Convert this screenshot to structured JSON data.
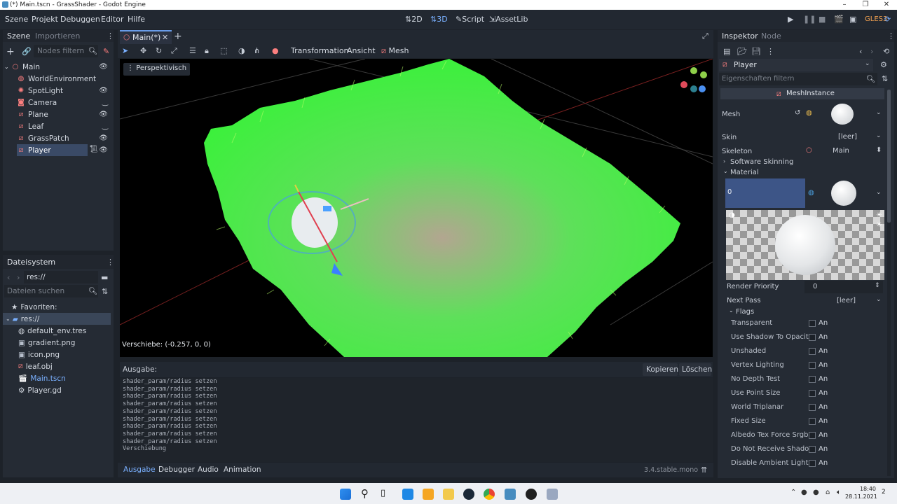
{
  "window": {
    "title": "(*) Main.tscn - GrassShader - Godot Engine"
  },
  "menu": [
    "Szene",
    "Projekt",
    "Debuggen",
    "Editor",
    "Hilfe"
  ],
  "workspaces": [
    {
      "label": "2D",
      "icon": "2d-icon"
    },
    {
      "label": "3D",
      "icon": "3d-icon"
    },
    {
      "label": "Script",
      "icon": "script-icon"
    },
    {
      "label": "AssetLib",
      "icon": "assetlib-icon"
    }
  ],
  "renderer": "GLES3",
  "scene_panel": {
    "tabs": [
      "Szene",
      "Importieren"
    ],
    "filter_placeholder": "Nodes filtern",
    "tree": [
      {
        "label": "Main",
        "icon": "node3d-icon",
        "color": "#fc7f7f"
      },
      {
        "label": "WorldEnvironment",
        "icon": "world-environment-icon",
        "color": "#fc7f7f"
      },
      {
        "label": "SpotLight",
        "icon": "spotlight-icon",
        "color": "#fc7f7f"
      },
      {
        "label": "Camera",
        "icon": "camera-icon",
        "color": "#fc7f7f"
      },
      {
        "label": "Plane",
        "icon": "meshinstance-icon",
        "color": "#fc7f7f"
      },
      {
        "label": "Leaf",
        "icon": "meshinstance-icon",
        "color": "#fc7f7f"
      },
      {
        "label": "GrassPatch",
        "icon": "meshinstance-icon",
        "color": "#fc7f7f"
      },
      {
        "label": "Player",
        "icon": "meshinstance-icon",
        "color": "#fc7f7f",
        "selected": true
      }
    ]
  },
  "filesystem": {
    "title": "Dateisystem",
    "path": "res://",
    "search_placeholder": "Dateien suchen",
    "favorites_label": "Favoriten:",
    "root": "res://",
    "files": [
      {
        "label": "default_env.tres",
        "icon": "environment-icon"
      },
      {
        "label": "gradient.png",
        "icon": "image-icon"
      },
      {
        "label": "icon.png",
        "icon": "image-icon"
      },
      {
        "label": "leaf.obj",
        "icon": "mesh-icon"
      },
      {
        "label": "Main.tscn",
        "icon": "scene-icon",
        "highlight": true
      },
      {
        "label": "Player.gd",
        "icon": "gear-icon"
      }
    ]
  },
  "editor_tabs": [
    {
      "label": "Main(*)"
    }
  ],
  "viewport_toolbar": {
    "transform_label": "Transformation",
    "view_label": "Ansicht",
    "mesh_label": "Mesh"
  },
  "viewport": {
    "perspective_label": "Perspektivisch",
    "status": "Verschiebe: (-0.257, 0, 0)"
  },
  "output": {
    "title": "Ausgabe:",
    "copy_label": "Kopieren",
    "clear_label": "Löschen",
    "lines": [
      "shader_param/radius setzen",
      "shader_param/radius setzen",
      "shader_param/radius setzen",
      "shader_param/radius setzen",
      "shader_param/radius setzen",
      "shader_param/radius setzen",
      "shader_param/radius setzen",
      "shader_param/radius setzen",
      "shader_param/radius setzen",
      "Verschiebung"
    ]
  },
  "bottom_tabs": [
    "Ausgabe",
    "Debugger",
    "Audio",
    "Animation"
  ],
  "version": "3.4.stable.mono",
  "inspector": {
    "tabs": [
      "Inspektor",
      "Node"
    ],
    "node_name": "Player",
    "filter_placeholder": "Eigenschaften filtern",
    "class_name": "MeshInstance",
    "mesh_label": "Mesh",
    "skin_label": "Skin",
    "skin_value": "[leer]",
    "skeleton_label": "Skeleton",
    "skeleton_value": "Main",
    "software_skinning": "Software Skinning",
    "material_label": "Material",
    "material_slot": "0",
    "render_priority_label": "Render Priority",
    "render_priority_value": "0",
    "next_pass_label": "Next Pass",
    "next_pass_value": "[leer]",
    "flags_label": "Flags",
    "flags": [
      {
        "label": "Transparent",
        "value": "An"
      },
      {
        "label": "Use Shadow To Opacity",
        "value": "An"
      },
      {
        "label": "Unshaded",
        "value": "An"
      },
      {
        "label": "Vertex Lighting",
        "value": "An"
      },
      {
        "label": "No Depth Test",
        "value": "An"
      },
      {
        "label": "Use Point Size",
        "value": "An"
      },
      {
        "label": "World Triplanar",
        "value": "An"
      },
      {
        "label": "Fixed Size",
        "value": "An"
      },
      {
        "label": "Albedo Tex Force Srgb",
        "value": "An"
      },
      {
        "label": "Do Not Receive Shadow",
        "value": "An"
      },
      {
        "label": "Disable Ambient Light",
        "value": "An"
      }
    ]
  },
  "taskbar": {
    "time": "18:40",
    "date": "28.11.2021",
    "notification_count": "2"
  },
  "colors": {
    "accent": "#699ce8",
    "selection": "#3a4a66",
    "grass": "#4cf04c"
  }
}
